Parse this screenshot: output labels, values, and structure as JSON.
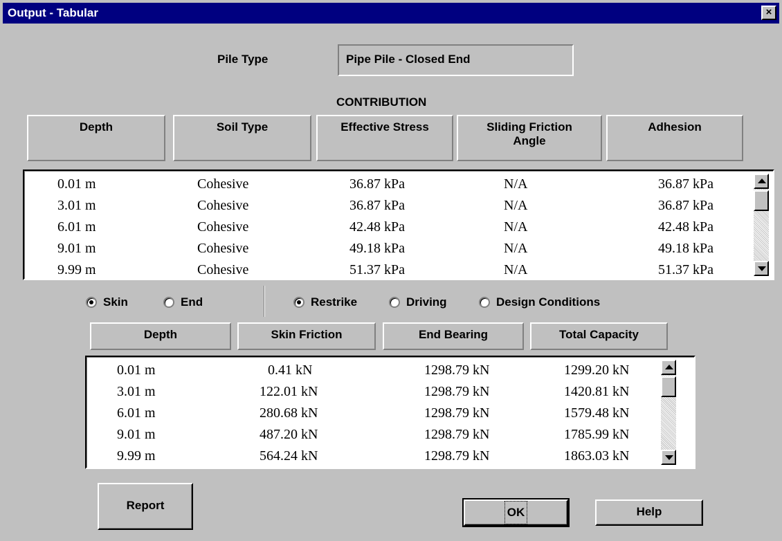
{
  "window": {
    "title": "Output - Tabular",
    "close_glyph": "×"
  },
  "pile_type": {
    "label": "Pile Type",
    "value": "Pipe Pile - Closed End"
  },
  "contribution": {
    "heading": "CONTRIBUTION",
    "columns": [
      "Depth",
      "Soil Type",
      "Effective Stress",
      "Sliding Friction",
      "Angle",
      "Adhesion"
    ],
    "rows": [
      [
        "0.01 m",
        "Cohesive",
        "36.87 kPa",
        "N/A",
        "36.87 kPa"
      ],
      [
        "3.01 m",
        "Cohesive",
        "36.87 kPa",
        "N/A",
        "36.87 kPa"
      ],
      [
        "6.01 m",
        "Cohesive",
        "42.48 kPa",
        "N/A",
        "42.48 kPa"
      ],
      [
        "9.01 m",
        "Cohesive",
        "49.18 kPa",
        "N/A",
        "49.18 kPa"
      ],
      [
        "9.99 m",
        "Cohesive",
        "51.37 kPa",
        "N/A",
        "51.37 kPa"
      ]
    ]
  },
  "options": {
    "skin": "Skin",
    "end": "End",
    "restrike": "Restrike",
    "driving": "Driving",
    "design": "Design Conditions",
    "selected_mode": "Skin",
    "selected_condition": "Restrike"
  },
  "capacity": {
    "columns": [
      "Depth",
      "Skin Friction",
      "End Bearing",
      "Total Capacity"
    ],
    "rows": [
      [
        "0.01 m",
        "0.41 kN",
        "1298.79 kN",
        "1299.20 kN"
      ],
      [
        "3.01 m",
        "122.01 kN",
        "1298.79 kN",
        "1420.81 kN"
      ],
      [
        "6.01 m",
        "280.68 kN",
        "1298.79 kN",
        "1579.48 kN"
      ],
      [
        "9.01 m",
        "487.20 kN",
        "1298.79 kN",
        "1785.99 kN"
      ],
      [
        "9.99 m",
        "564.24 kN",
        "1298.79 kN",
        "1863.03 kN"
      ]
    ]
  },
  "buttons": {
    "report": "Report",
    "ok": "OK",
    "help": "Help"
  }
}
